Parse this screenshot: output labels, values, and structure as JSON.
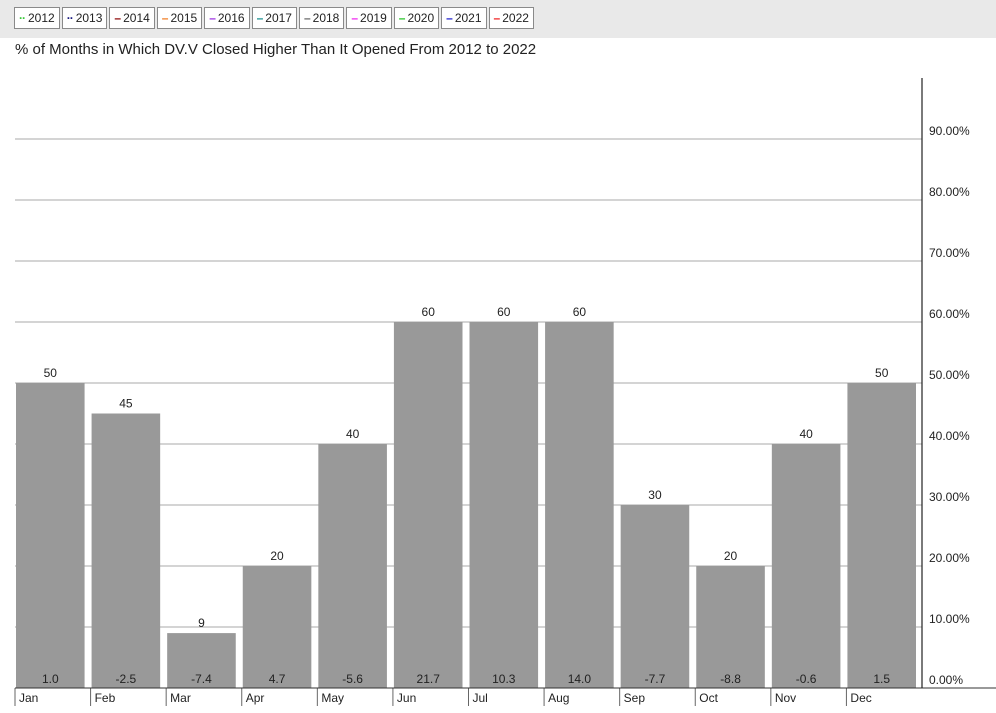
{
  "legend": [
    {
      "label": "2012",
      "color": "#3cc83c",
      "style": "dotted"
    },
    {
      "label": "2013",
      "color": "#1a1a80",
      "style": "dotted"
    },
    {
      "label": "2014",
      "color": "#8b0000",
      "style": "solid"
    },
    {
      "label": "2015",
      "color": "#f07a1e",
      "style": "solid"
    },
    {
      "label": "2016",
      "color": "#9a2be2",
      "style": "solid"
    },
    {
      "label": "2017",
      "color": "#138c8c",
      "style": "solid"
    },
    {
      "label": "2018",
      "color": "#666666",
      "style": "solid"
    },
    {
      "label": "2019",
      "color": "#f020f0",
      "style": "solid"
    },
    {
      "label": "2020",
      "color": "#22c322",
      "style": "solid"
    },
    {
      "label": "2021",
      "color": "#1a1acc",
      "style": "solid"
    },
    {
      "label": "2022",
      "color": "#f01a1a",
      "style": "solid"
    }
  ],
  "chart_data": {
    "type": "bar",
    "title": "% of Months in Which DV.V Closed Higher Than It Opened From 2012 to 2022",
    "categories": [
      "Jan",
      "Feb",
      "Mar",
      "Apr",
      "May",
      "Jun",
      "Jul",
      "Aug",
      "Sep",
      "Oct",
      "Nov",
      "Dec"
    ],
    "values": [
      50,
      45,
      9,
      20,
      40,
      60,
      60,
      60,
      30,
      20,
      40,
      50
    ],
    "value_labels": [
      "50",
      "45",
      "9",
      "20",
      "40",
      "60",
      "60",
      "60",
      "30",
      "20",
      "40",
      "50"
    ],
    "bottom_labels": [
      "1.0",
      "-2.5",
      "-7.4",
      "4.7",
      "-5.6",
      "21.7",
      "10.3",
      "14.0",
      "-7.7",
      "-8.8",
      "-0.6",
      "1.5"
    ],
    "yticks": [
      0,
      10,
      20,
      30,
      40,
      50,
      60,
      70,
      80,
      90
    ],
    "ytick_labels": [
      "0.00%",
      "10.00%",
      "20.00%",
      "30.00%",
      "40.00%",
      "50.00%",
      "60.00%",
      "70.00%",
      "80.00%",
      "90.00%"
    ],
    "ylim": [
      0,
      100
    ],
    "yaxis_side": "right",
    "grid": true,
    "bar_color": "#999999",
    "grid_color": "#a8a8a8"
  }
}
